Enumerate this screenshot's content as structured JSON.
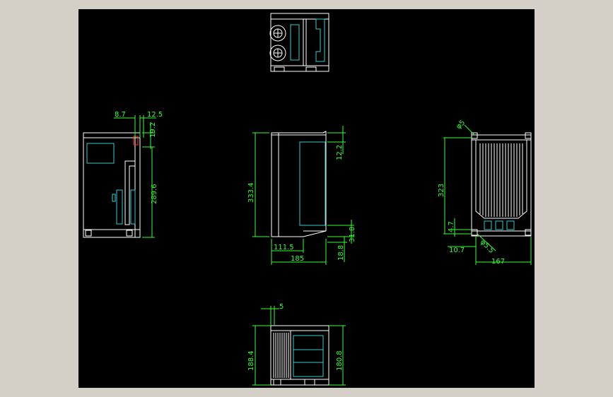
{
  "colors": {
    "background": "#000000",
    "frame": "#d4d0c8",
    "outline": "#ffffff",
    "dimension": "#33ff33",
    "detail": "#33cccc",
    "accent": "#ff3333"
  },
  "dimensions": {
    "left_top_a": "8.7",
    "left_top_b": "12.5",
    "left_top_c": "19.2",
    "left_height": "289.6",
    "front_height": "333.4",
    "front_top_offset": "12.2",
    "front_bottom_offset": "31.8",
    "front_base": "18.8",
    "front_inner_width": "111.5",
    "front_width": "185",
    "right_hole_a": "φ5",
    "right_height": "323",
    "right_offset_v": "4.7",
    "right_offset_h": "10.7",
    "right_hole_b": "φ5.5",
    "right_width": "167",
    "bottom_offset": "5",
    "bottom_height_left": "188.4",
    "bottom_height_right": "180.8"
  }
}
